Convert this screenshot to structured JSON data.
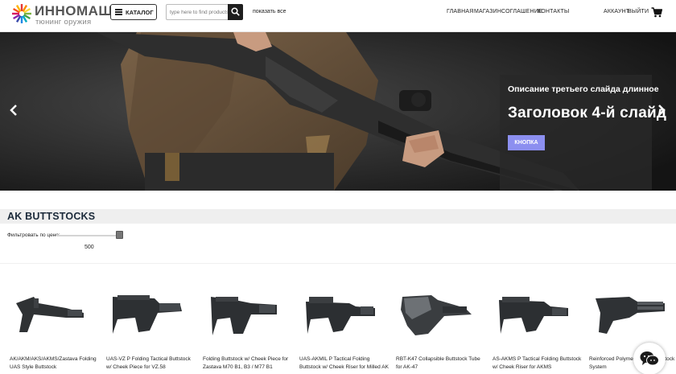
{
  "header": {
    "logo_name": "ИННОМАШ",
    "logo_tagline": "тюнинг оружия",
    "catalog_label": "КАТАЛОГ",
    "search_placeholder": "type here to find products",
    "show_all": "показать все",
    "nav": [
      "ГЛАВНАЯ",
      "МАГАЗИН",
      "СОГЛАШЕНИЕ",
      "КОНТАКТЫ"
    ],
    "account": "АККАУНТ",
    "logout": "ВЫЙТИ"
  },
  "slider": {
    "description": "Описание третьего слайда длинное",
    "title": "Заголовок 4-й слайд",
    "button": "КНОПКА"
  },
  "section": {
    "title": "AK BUTTSTOCKS",
    "filter_label": "Фильтровать по цене:",
    "filter_value": "500"
  },
  "products": [
    {
      "name": "AK/AKM/AKS/AKMS/Zastava Folding UAS Style Buttstock"
    },
    {
      "name": "UAS-VZ P Folding Tactical Buttstock w/ Cheek Piece for VZ.58"
    },
    {
      "name": "Folding Buttstock w/ Cheek Piece for Zastava M70 B1, B3 / M77 B1"
    },
    {
      "name": "UAS-AKMIL P Tactical Folding Buttstock w/ Cheek Riser for Milled AK"
    },
    {
      "name": "RBT-K47 Collapsible Buttstock Tube for AK-47"
    },
    {
      "name": "AS-AKMS P Tactical Folding Buttstock w/ Cheek Riser for AKMS"
    },
    {
      "name": "Reinforced Polymer Sniper Buttstock System"
    }
  ],
  "colors": {
    "accent_button": "#8c8ff0",
    "section_title": "#1b2a3a",
    "logo_text": "#555555"
  },
  "icons": [
    "logo-sunburst-icon",
    "menu-icon",
    "search-icon",
    "cart-icon",
    "chevron-left-icon",
    "chevron-right-icon",
    "chat-icon"
  ]
}
